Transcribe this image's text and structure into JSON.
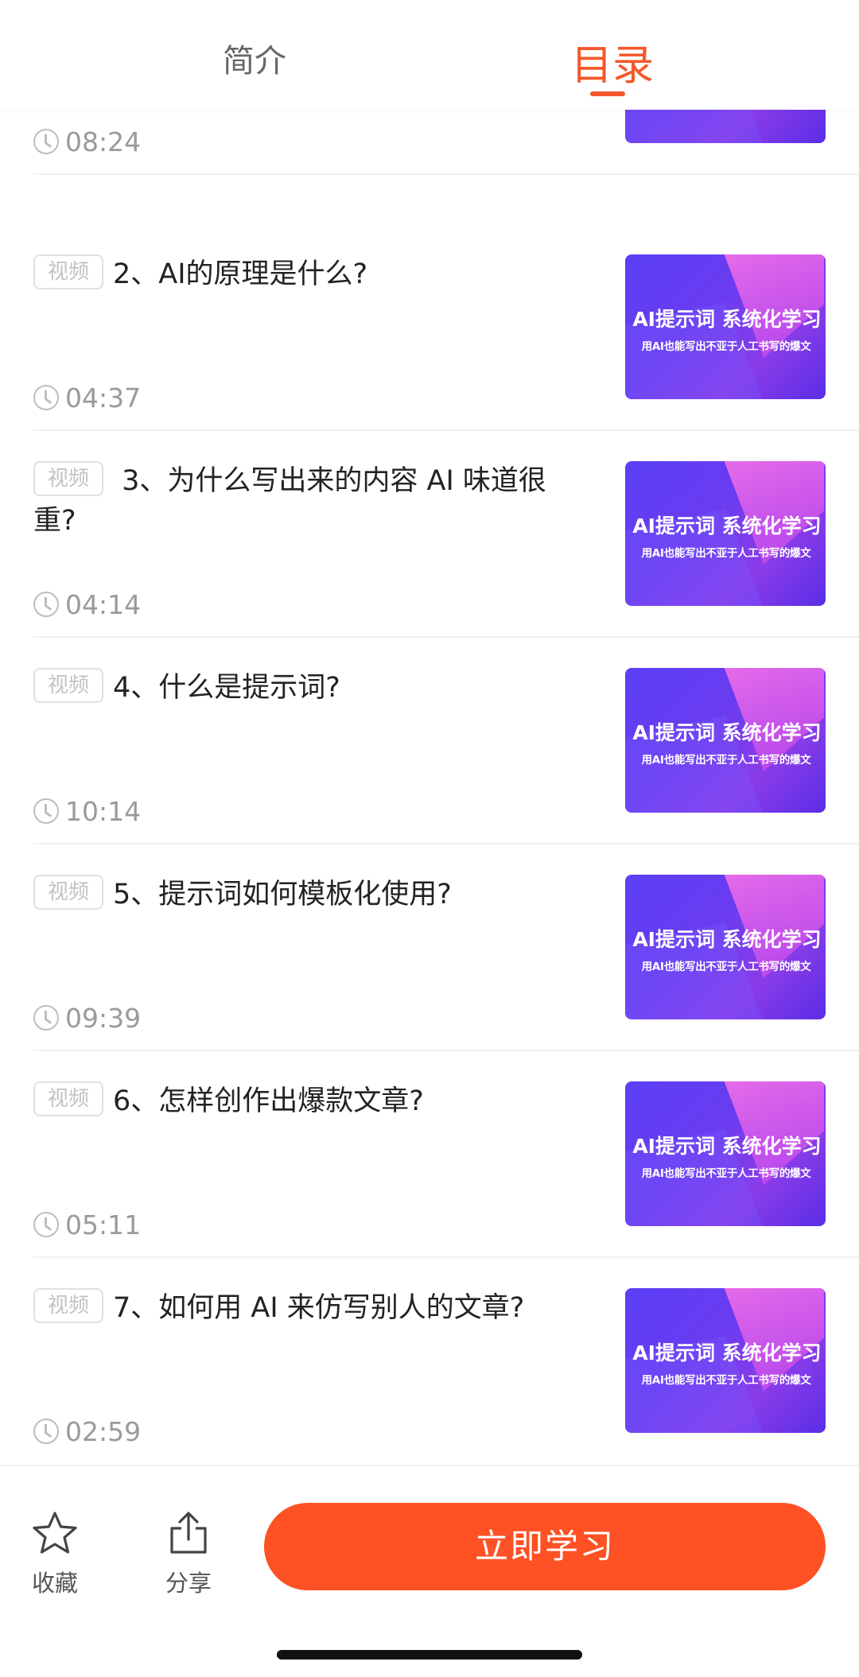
{
  "tabs": {
    "intro": "简介",
    "catalog": "目录",
    "active": "catalog"
  },
  "thumbnail": {
    "title": "AI提示词 系统化学习",
    "subtitle": "用AI也能写出不亚于人工书写的爆文"
  },
  "badge_label": "视频",
  "lessons": [
    {
      "title": "",
      "duration": "08:24"
    },
    {
      "title": "2、AI的原理是什么?",
      "duration": "04:37"
    },
    {
      "title": " 3、为什么写出来的内容 AI 味道很重?",
      "duration": "04:14"
    },
    {
      "title": "4、什么是提示词?",
      "duration": "10:14"
    },
    {
      "title": "5、提示词如何模板化使用?",
      "duration": "09:39"
    },
    {
      "title": "6、怎样创作出爆款文章?",
      "duration": "05:11"
    },
    {
      "title": "7、如何用 AI 来仿写别人的文章?",
      "duration": "02:59"
    }
  ],
  "bottom_bar": {
    "favorite_label": "收藏",
    "share_label": "分享",
    "cta_label": "立即学习"
  },
  "colors": {
    "accent": "#f4582a",
    "cta": "#fe5124"
  }
}
